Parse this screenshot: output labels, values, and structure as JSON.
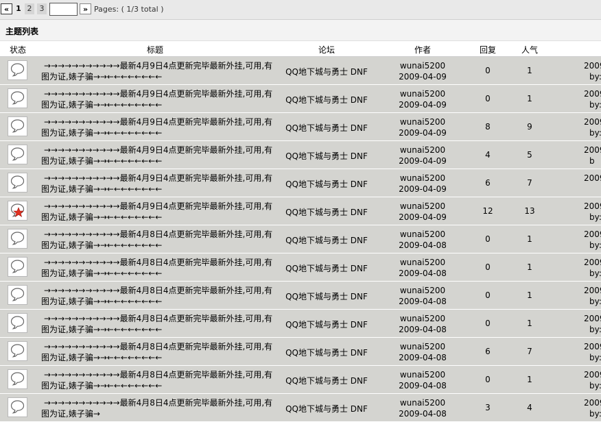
{
  "pager": {
    "prev_label": "«",
    "pages": [
      "1",
      "2",
      "3"
    ],
    "current_page": "1",
    "jump_value": "",
    "next_label": "»",
    "info": "Pages: ( 1/3 total )"
  },
  "section_title": "主题列表",
  "columns": {
    "status": "状态",
    "title": "标题",
    "forum": "论坛",
    "author": "作者",
    "replies": "回复",
    "views": "人气"
  },
  "rows": [
    {
      "icon": "topic-normal-icon",
      "title_l1": "→→→→→→→→→→→最新4月9日4点更新完毕最新外挂,可用,有",
      "title_l2": "图为证,婊子骗→→←←←←←←←←",
      "forum": "QQ地下城与勇士 DNF",
      "author": "wunai5200",
      "date": "2009-04-09",
      "replies": "0",
      "views": "1",
      "last_date": "2009",
      "last_by": "by:"
    },
    {
      "icon": "topic-normal-icon",
      "title_l1": "→→→→→→→→→→→最新4月9日4点更新完毕最新外挂,可用,有",
      "title_l2": "图为证,婊子骗→→←←←←←←←←",
      "forum": "QQ地下城与勇士 DNF",
      "author": "wunai5200",
      "date": "2009-04-09",
      "replies": "0",
      "views": "1",
      "last_date": "2009",
      "last_by": "by:"
    },
    {
      "icon": "topic-normal-icon",
      "title_l1": "→→→→→→→→→→→最新4月9日4点更新完毕最新外挂,可用,有",
      "title_l2": "图为证,婊子骗→→←←←←←←←←",
      "forum": "QQ地下城与勇士 DNF",
      "author": "wunai5200",
      "date": "2009-04-09",
      "replies": "8",
      "views": "9",
      "last_date": "2009",
      "last_by": "by:"
    },
    {
      "icon": "topic-normal-icon",
      "title_l1": "→→→→→→→→→→→最新4月9日4点更新完毕最新外挂,可用,有",
      "title_l2": "图为证,婊子骗→→←←←←←←←←",
      "forum": "QQ地下城与勇士 DNF",
      "author": "wunai5200",
      "date": "2009-04-09",
      "replies": "4",
      "views": "5",
      "last_date": "2009",
      "last_by": "b"
    },
    {
      "icon": "topic-normal-icon",
      "title_l1": "→→→→→→→→→→→最新4月9日4点更新完毕最新外挂,可用,有",
      "title_l2": "图为证,婊子骗→→←←←←←←←←",
      "forum": "QQ地下城与勇士 DNF",
      "author": "wunai5200",
      "date": "2009-04-09",
      "replies": "6",
      "views": "7",
      "last_date": "2009",
      "last_by": ""
    },
    {
      "icon": "topic-hot-icon",
      "title_l1": "→→→→→→→→→→→最新4月9日4点更新完毕最新外挂,可用,有",
      "title_l2": "图为证,婊子骗→→←←←←←←←←",
      "forum": "QQ地下城与勇士 DNF",
      "author": "wunai5200",
      "date": "2009-04-09",
      "replies": "12",
      "views": "13",
      "last_date": "2009",
      "last_by": "by:"
    },
    {
      "icon": "topic-normal-icon",
      "title_l1": "→→→→→→→→→→→最新4月8日4点更新完毕最新外挂,可用,有",
      "title_l2": "图为证,婊子骗→→←←←←←←←←",
      "forum": "QQ地下城与勇士 DNF",
      "author": "wunai5200",
      "date": "2009-04-08",
      "replies": "0",
      "views": "1",
      "last_date": "2009",
      "last_by": "by:"
    },
    {
      "icon": "topic-normal-icon",
      "title_l1": "→→→→→→→→→→→最新4月8日4点更新完毕最新外挂,可用,有",
      "title_l2": "图为证,婊子骗→→←←←←←←←←",
      "forum": "QQ地下城与勇士 DNF",
      "author": "wunai5200",
      "date": "2009-04-08",
      "replies": "0",
      "views": "1",
      "last_date": "2009",
      "last_by": "by:"
    },
    {
      "icon": "topic-normal-icon",
      "title_l1": "→→→→→→→→→→→最新4月8日4点更新完毕最新外挂,可用,有",
      "title_l2": "图为证,婊子骗→→←←←←←←←←",
      "forum": "QQ地下城与勇士 DNF",
      "author": "wunai5200",
      "date": "2009-04-08",
      "replies": "0",
      "views": "1",
      "last_date": "2009",
      "last_by": "by:"
    },
    {
      "icon": "topic-normal-icon",
      "title_l1": "→→→→→→→→→→→最新4月8日4点更新完毕最新外挂,可用,有",
      "title_l2": "图为证,婊子骗→→←←←←←←←←",
      "forum": "QQ地下城与勇士 DNF",
      "author": "wunai5200",
      "date": "2009-04-08",
      "replies": "0",
      "views": "1",
      "last_date": "2009",
      "last_by": "by:"
    },
    {
      "icon": "topic-normal-icon",
      "title_l1": "→→→→→→→→→→→最新4月8日4点更新完毕最新外挂,可用,有",
      "title_l2": "图为证,婊子骗→→←←←←←←←←",
      "forum": "QQ地下城与勇士 DNF",
      "author": "wunai5200",
      "date": "2009-04-08",
      "replies": "6",
      "views": "7",
      "last_date": "2009",
      "last_by": "by:"
    },
    {
      "icon": "topic-normal-icon",
      "title_l1": "→→→→→→→→→→→最新4月8日4点更新完毕最新外挂,可用,有",
      "title_l2": "图为证,婊子骗→→←←←←←←←←",
      "forum": "QQ地下城与勇士 DNF",
      "author": "wunai5200",
      "date": "2009-04-08",
      "replies": "0",
      "views": "1",
      "last_date": "2009",
      "last_by": "by:"
    },
    {
      "icon": "topic-normal-icon",
      "title_l1": "→→→→→→→→→→→最新4月8日4点更新完毕最新外挂,可用,有",
      "title_l2": "图为证,婊子骗→",
      "forum": "QQ地下城与勇士 DNF",
      "author": "wunai5200",
      "date": "2009-04-08",
      "replies": "3",
      "views": "4",
      "last_date": "2009",
      "last_by": "by:"
    }
  ],
  "colors": {
    "row_bg": "#d4d4d0",
    "pager_bg": "#e9e9e9",
    "hot_star": "#e03020"
  }
}
